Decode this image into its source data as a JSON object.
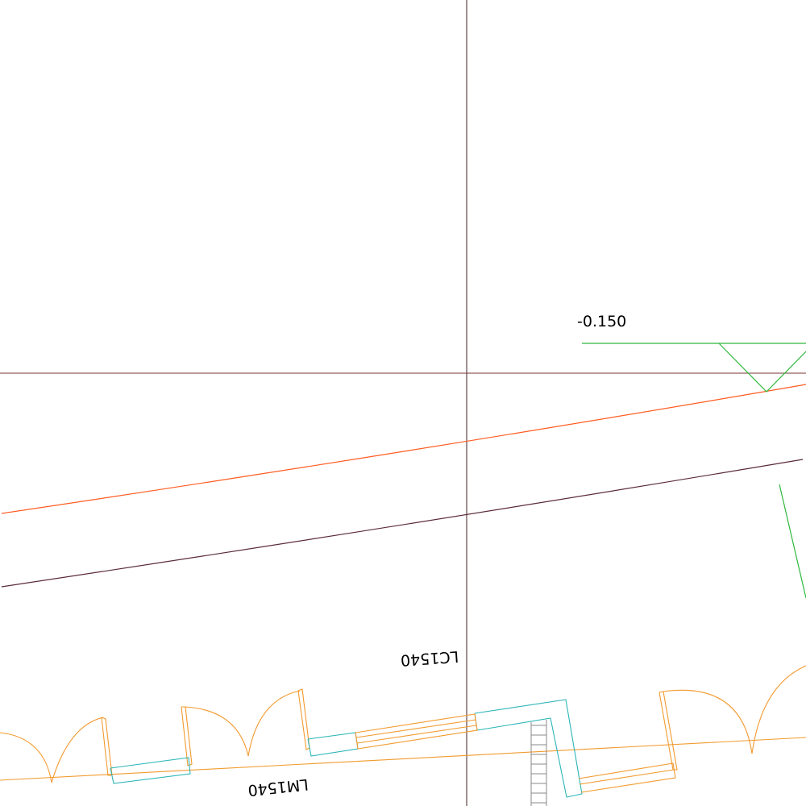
{
  "drawing": {
    "elevation_mark": "-0.150",
    "window_tag": "LC1540",
    "door_tag": "LM1540"
  },
  "colors": {
    "background": "#ffffff",
    "axis_grid": "#5e4545",
    "axis_grid_horizontal": "#7a3434",
    "curve_orange": "#ff5a1f",
    "curve_dark": "#5a2a3a",
    "wall_orange": "#f29a2e",
    "glazing_cyan": "#2cb5b8",
    "symbol_green": "#2db83d",
    "stair_grey": "#8a8a8a",
    "text": "#000000"
  }
}
